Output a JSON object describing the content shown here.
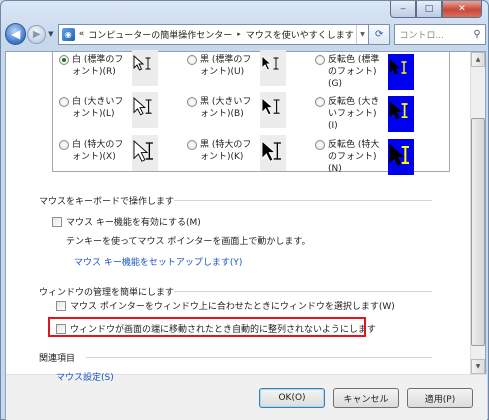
{
  "window": {
    "minimize_label": "‒",
    "maximize_label": "□",
    "close_label": "✕"
  },
  "nav": {
    "back_label": "◀",
    "forward_label": "▶",
    "history_label": "▼",
    "crumb_prefix": "«",
    "crumbs": [
      "コンピューターの簡単操作センター",
      "マウスを使いやすくします"
    ],
    "crumb_separator": "▸",
    "refresh_label": "⟳",
    "search_placeholder": "コントロ..."
  },
  "pointer_schemes": [
    {
      "label": "白 (標準のフォント)(R)",
      "selected": true,
      "inverted": false,
      "size": "normal"
    },
    {
      "label": "黒 (標準のフォント)(U)",
      "selected": false,
      "inverted": false,
      "size": "normal"
    },
    {
      "label": "反転色 (標準のフォント)(G)",
      "selected": false,
      "inverted": true,
      "size": "normal"
    },
    {
      "label": "白 (大きいフォント)(L)",
      "selected": false,
      "inverted": false,
      "size": "large"
    },
    {
      "label": "黒 (大きいフォント)(B)",
      "selected": false,
      "inverted": false,
      "size": "large"
    },
    {
      "label": "反転色 (大きいフォント)(I)",
      "selected": false,
      "inverted": true,
      "size": "large"
    },
    {
      "label": "白 (特大のフォント)(X)",
      "selected": false,
      "inverted": false,
      "size": "xlarge"
    },
    {
      "label": "黒 (特大のフォント)(K)",
      "selected": false,
      "inverted": false,
      "size": "xlarge"
    },
    {
      "label": "反転色 (特大のフォント)(N)",
      "selected": false,
      "inverted": true,
      "size": "xlarge"
    }
  ],
  "mouse_keys": {
    "title": "マウスをキーボードで操作します",
    "checkbox_label": "マウス キー機能を有効にする(M)",
    "description": "テンキーを使ってマウス ポインターを画面上で動かします。",
    "setup_link": "マウス キー機能をセットアップします(Y)"
  },
  "window_management": {
    "title": "ウィンドウの管理を簡単にします",
    "hover_select_label": "マウス ポインターをウィンドウ上に合わせたときにウィンドウを選択します(W)",
    "prevent_arrange_label": "ウィンドウが画面の端に移動されたとき自動的に整列されないようにします"
  },
  "related": {
    "title": "関連項目",
    "mouse_settings_link": "マウス設定(S)"
  },
  "buttons": {
    "ok": "OK(O)",
    "cancel": "キャンセル",
    "apply": "適用(P)"
  }
}
